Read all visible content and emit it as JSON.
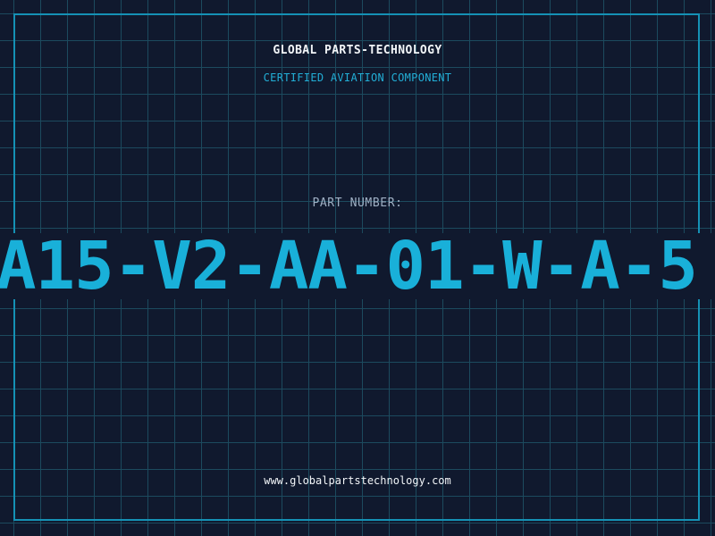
{
  "header": {
    "company": "GLOBAL PARTS-TECHNOLOGY",
    "tagline": "CERTIFIED AVIATION COMPONENT"
  },
  "part": {
    "label": "PART NUMBER:",
    "number": "A15-V2-AA-01-W-A-5"
  },
  "footer": {
    "website": "www.globalpartstechnology.com"
  },
  "colors": {
    "background": "#10192e",
    "grid": "#1c4a5e",
    "frame": "#1591b5",
    "accent": "#19b0d9",
    "text": "#f2f5f8",
    "label": "#9fb0c4"
  }
}
